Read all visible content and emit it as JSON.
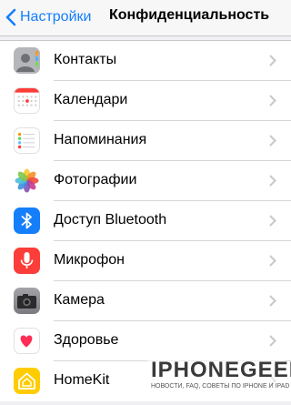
{
  "nav": {
    "back_label": "Настройки",
    "title": "Конфиденциальность"
  },
  "rows": [
    {
      "label": "Контакты",
      "icon": "contacts-icon",
      "color": "#b7b8bb"
    },
    {
      "label": "Календари",
      "icon": "calendar-icon",
      "color": "#ffffff"
    },
    {
      "label": "Напоминания",
      "icon": "reminders-icon",
      "color": "#ffffff"
    },
    {
      "label": "Фотографии",
      "icon": "photos-icon",
      "color": "#ffffff"
    },
    {
      "label": "Доступ Bluetooth",
      "icon": "bluetooth-icon",
      "color": "#157efb"
    },
    {
      "label": "Микрофон",
      "icon": "microphone-icon",
      "color": "#fc3d39"
    },
    {
      "label": "Камера",
      "icon": "camera-icon",
      "color": "#8e8e93"
    },
    {
      "label": "Здоровье",
      "icon": "health-icon",
      "color": "#ffffff"
    },
    {
      "label": "HomeKit",
      "icon": "homekit-icon",
      "color": "#ffcc00"
    }
  ],
  "watermark": {
    "title": "IPHONEGEEK",
    "subtitle": "НОВОСТИ, FAQ, СОВЕТЫ ПО IPHONE И IPAD"
  },
  "colors": {
    "accent": "#157efb",
    "background": "#efeff4"
  }
}
